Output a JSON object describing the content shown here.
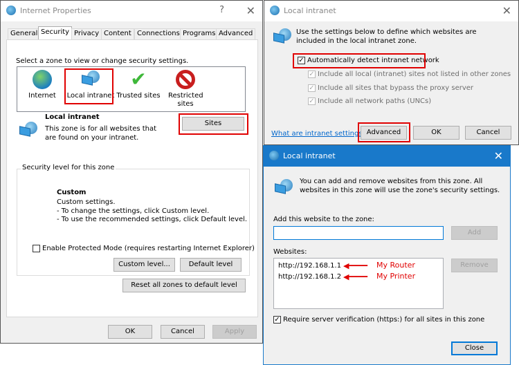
{
  "internet_properties": {
    "title": "Internet Properties",
    "help": "?",
    "close": "✕",
    "tabs": [
      "General",
      "Security",
      "Privacy",
      "Content",
      "Connections",
      "Programs",
      "Advanced"
    ],
    "select_zone_label": "Select a zone to view or change security settings.",
    "zones": [
      {
        "label": "Internet",
        "icon": "globe-icon"
      },
      {
        "label": "Local intranet",
        "icon": "intranet-icon"
      },
      {
        "label": "Trusted sites",
        "icon": "checkmark-icon"
      },
      {
        "label": "Restricted sites",
        "icon": "forbidden-icon"
      }
    ],
    "zone_title": "Local intranet",
    "zone_desc": "This zone is for all websites that are found on your intranet.",
    "sites_button": "Sites",
    "security_level_label": "Security level for this zone",
    "level_name": "Custom",
    "level_lines": [
      "Custom settings.",
      "- To change the settings, click Custom level.",
      "- To use the recommended settings, click Default level."
    ],
    "protected_mode": {
      "label": "Enable Protected Mode (requires restarting Internet Explorer)",
      "checked": false
    },
    "custom_level_button": "Custom level...",
    "default_level_button": "Default level",
    "reset_button": "Reset all zones to default level",
    "ok": "OK",
    "cancel": "Cancel",
    "apply": "Apply"
  },
  "intranet_settings": {
    "title": "Local intranet",
    "close": "✕",
    "description": "Use the settings below to define which websites are included in the local intranet zone.",
    "auto_detect": {
      "label": "Automatically detect intranet network",
      "checked": true
    },
    "options": [
      {
        "label": "Include all local (intranet) sites not listed in other zones",
        "checked": true
      },
      {
        "label": "Include all sites that bypass the proxy server",
        "checked": true
      },
      {
        "label": "Include all network paths (UNCs)",
        "checked": true
      }
    ],
    "help_link": "What are intranet settings?",
    "advanced": "Advanced",
    "ok": "OK",
    "cancel": "Cancel"
  },
  "sites_dialog": {
    "title": "Local intranet",
    "close": "✕",
    "description": "You can add and remove websites from this zone. All websites in this zone will use the zone's security settings.",
    "add_label": "Add this website to the zone:",
    "add_value": "",
    "add_button": "Add",
    "websites_label": "Websites:",
    "websites": [
      {
        "url": "http://192.168.1.1",
        "annotation": "My Router"
      },
      {
        "url": "http://192.168.1.2",
        "annotation": "My Printer"
      }
    ],
    "remove_button": "Remove",
    "require_https": {
      "label": "Require server verification (https:) for all sites in this zone",
      "checked": true
    },
    "close_button": "Close"
  },
  "colors": {
    "highlight": "#e00000",
    "titlebar_active": "#1979ca"
  }
}
